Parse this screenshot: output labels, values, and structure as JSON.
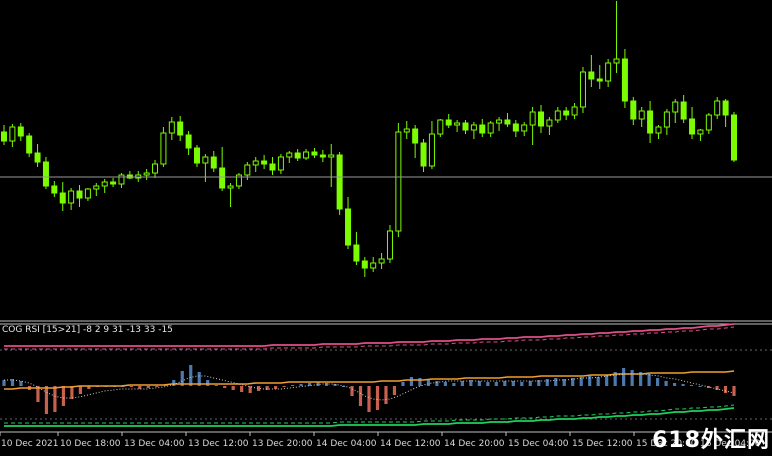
{
  "indicator": {
    "title": "COG RSI [15>21] -8 2 9 31 -13 33 -15"
  },
  "time_axis": {
    "labels": [
      "10 Dec 2021",
      "10 Dec 18:00",
      "13 Dec 04:00",
      "13 Dec 12:00",
      "13 Dec 20:00",
      "14 Dec 04:00",
      "14 Dec 12:00",
      "14 Dec 20:00",
      "15 Dec 04:00",
      "15 Dec 12:00",
      "15 Dec 20:00",
      "16 Dec 04:00"
    ]
  },
  "watermark": "618外汇网",
  "colors": {
    "background": "#000000",
    "candle": "#7CFC00",
    "hline": "#9a9a9a",
    "bar_up": "#4a7ab0",
    "bar_down": "#c8604e",
    "orange": "#f0a030",
    "pink": "#e0508a",
    "green": "#20d060",
    "dotted": "#d0d0d0"
  },
  "chart_data": {
    "type": "candlestick",
    "title": "",
    "note": "Price axis tick labels are not visible in the screenshot; values are relative levels (0-100).",
    "candles": [
      {
        "o": 45,
        "h": 52,
        "l": 32,
        "c": 36
      },
      {
        "o": 36,
        "h": 53,
        "l": 30,
        "c": 50
      },
      {
        "o": 50,
        "h": 54,
        "l": 36,
        "c": 41
      },
      {
        "o": 41,
        "h": 44,
        "l": 20,
        "c": 24
      },
      {
        "o": 24,
        "h": 33,
        "l": 10,
        "c": 15
      },
      {
        "o": 15,
        "h": 20,
        "l": -12,
        "c": -9
      },
      {
        "o": -9,
        "h": -4,
        "l": -20,
        "c": -16
      },
      {
        "o": -16,
        "h": -5,
        "l": -34,
        "c": -26
      },
      {
        "o": -26,
        "h": -11,
        "l": -33,
        "c": -14
      },
      {
        "o": -14,
        "h": -8,
        "l": -30,
        "c": -21
      },
      {
        "o": -21,
        "h": -11,
        "l": -24,
        "c": -12
      },
      {
        "o": -12,
        "h": -6,
        "l": -19,
        "c": -9
      },
      {
        "o": -9,
        "h": -2,
        "l": -16,
        "c": -5
      },
      {
        "o": -5,
        "h": -1,
        "l": -10,
        "c": -7
      },
      {
        "o": -7,
        "h": 4,
        "l": -11,
        "c": 2
      },
      {
        "o": 2,
        "h": 6,
        "l": -2,
        "c": -1
      },
      {
        "o": -1,
        "h": 6,
        "l": -5,
        "c": 2
      },
      {
        "o": 2,
        "h": 8,
        "l": -3,
        "c": 4
      },
      {
        "o": 4,
        "h": 17,
        "l": -1,
        "c": 13
      },
      {
        "o": 13,
        "h": 50,
        "l": 10,
        "c": 44
      },
      {
        "o": 44,
        "h": 60,
        "l": 37,
        "c": 55
      },
      {
        "o": 55,
        "h": 61,
        "l": 36,
        "c": 42
      },
      {
        "o": 42,
        "h": 46,
        "l": 22,
        "c": 29
      },
      {
        "o": 29,
        "h": 32,
        "l": 10,
        "c": 14
      },
      {
        "o": 14,
        "h": 23,
        "l": -5,
        "c": 20
      },
      {
        "o": 20,
        "h": 26,
        "l": 5,
        "c": 9
      },
      {
        "o": 9,
        "h": 30,
        "l": -14,
        "c": -11
      },
      {
        "o": -11,
        "h": -6,
        "l": -30,
        "c": -9
      },
      {
        "o": -9,
        "h": 4,
        "l": -12,
        "c": 2
      },
      {
        "o": 2,
        "h": 15,
        "l": -3,
        "c": 12
      },
      {
        "o": 12,
        "h": 20,
        "l": 5,
        "c": 16
      },
      {
        "o": 16,
        "h": 22,
        "l": 8,
        "c": 13
      },
      {
        "o": 13,
        "h": 20,
        "l": 2,
        "c": 7
      },
      {
        "o": 7,
        "h": 23,
        "l": 3,
        "c": 20
      },
      {
        "o": 20,
        "h": 26,
        "l": 14,
        "c": 24
      },
      {
        "o": 24,
        "h": 28,
        "l": 16,
        "c": 19
      },
      {
        "o": 19,
        "h": 28,
        "l": 17,
        "c": 25
      },
      {
        "o": 25,
        "h": 29,
        "l": 19,
        "c": 22
      },
      {
        "o": 22,
        "h": 27,
        "l": 15,
        "c": 20
      },
      {
        "o": 20,
        "h": 33,
        "l": -10,
        "c": 22
      },
      {
        "o": 22,
        "h": 25,
        "l": -38,
        "c": -32
      },
      {
        "o": -32,
        "h": -20,
        "l": -72,
        "c": -68
      },
      {
        "o": -68,
        "h": -55,
        "l": -88,
        "c": -84
      },
      {
        "o": -84,
        "h": -80,
        "l": -100,
        "c": -91
      },
      {
        "o": -91,
        "h": -80,
        "l": -95,
        "c": -86
      },
      {
        "o": -86,
        "h": -76,
        "l": -92,
        "c": -82
      },
      {
        "o": -82,
        "h": -48,
        "l": -86,
        "c": -54
      },
      {
        "o": -54,
        "h": 54,
        "l": -60,
        "c": 45
      },
      {
        "o": 45,
        "h": 56,
        "l": 38,
        "c": 48
      },
      {
        "o": 48,
        "h": 52,
        "l": 19,
        "c": 34
      },
      {
        "o": 34,
        "h": 38,
        "l": 5,
        "c": 11
      },
      {
        "o": 11,
        "h": 56,
        "l": 8,
        "c": 43
      },
      {
        "o": 43,
        "h": 58,
        "l": 40,
        "c": 57
      },
      {
        "o": 57,
        "h": 63,
        "l": 49,
        "c": 52
      },
      {
        "o": 52,
        "h": 57,
        "l": 45,
        "c": 54
      },
      {
        "o": 54,
        "h": 57,
        "l": 43,
        "c": 47
      },
      {
        "o": 47,
        "h": 55,
        "l": 38,
        "c": 52
      },
      {
        "o": 52,
        "h": 58,
        "l": 40,
        "c": 44
      },
      {
        "o": 44,
        "h": 56,
        "l": 40,
        "c": 54
      },
      {
        "o": 54,
        "h": 60,
        "l": 46,
        "c": 57
      },
      {
        "o": 57,
        "h": 64,
        "l": 50,
        "c": 53
      },
      {
        "o": 53,
        "h": 57,
        "l": 40,
        "c": 46
      },
      {
        "o": 46,
        "h": 55,
        "l": 41,
        "c": 52
      },
      {
        "o": 52,
        "h": 70,
        "l": 32,
        "c": 65
      },
      {
        "o": 65,
        "h": 72,
        "l": 44,
        "c": 51
      },
      {
        "o": 51,
        "h": 60,
        "l": 42,
        "c": 57
      },
      {
        "o": 57,
        "h": 70,
        "l": 54,
        "c": 66
      },
      {
        "o": 66,
        "h": 70,
        "l": 57,
        "c": 62
      },
      {
        "o": 62,
        "h": 74,
        "l": 58,
        "c": 70
      },
      {
        "o": 70,
        "h": 110,
        "l": 64,
        "c": 105
      },
      {
        "o": 105,
        "h": 122,
        "l": 90,
        "c": 98
      },
      {
        "o": 98,
        "h": 112,
        "l": 88,
        "c": 96
      },
      {
        "o": 96,
        "h": 118,
        "l": 90,
        "c": 114
      },
      {
        "o": 114,
        "h": 176,
        "l": 104,
        "c": 118
      },
      {
        "o": 118,
        "h": 128,
        "l": 69,
        "c": 76
      },
      {
        "o": 76,
        "h": 80,
        "l": 52,
        "c": 58
      },
      {
        "o": 58,
        "h": 70,
        "l": 50,
        "c": 66
      },
      {
        "o": 66,
        "h": 76,
        "l": 34,
        "c": 44
      },
      {
        "o": 44,
        "h": 52,
        "l": 38,
        "c": 50
      },
      {
        "o": 50,
        "h": 68,
        "l": 42,
        "c": 65
      },
      {
        "o": 65,
        "h": 78,
        "l": 54,
        "c": 75
      },
      {
        "o": 75,
        "h": 82,
        "l": 54,
        "c": 58
      },
      {
        "o": 58,
        "h": 70,
        "l": 38,
        "c": 43
      },
      {
        "o": 43,
        "h": 48,
        "l": 36,
        "c": 47
      },
      {
        "o": 47,
        "h": 64,
        "l": 43,
        "c": 62
      },
      {
        "o": 62,
        "h": 80,
        "l": 58,
        "c": 76
      },
      {
        "o": 76,
        "h": 78,
        "l": 50,
        "c": 62
      },
      {
        "o": 62,
        "h": 65,
        "l": 15,
        "c": 17
      }
    ],
    "indicator_bars": [
      6,
      7,
      5,
      -4,
      -16,
      -28,
      -26,
      -20,
      -13,
      -8,
      -3,
      -1,
      0,
      0,
      0,
      -1,
      -3,
      -2,
      -1,
      1,
      6,
      15,
      21,
      14,
      6,
      1,
      -2,
      -4,
      -6,
      -7,
      -5,
      -4,
      -3,
      -1,
      1,
      2,
      3,
      4,
      3,
      2,
      0,
      -10,
      -20,
      -26,
      -24,
      -18,
      -9,
      4,
      9,
      8,
      7,
      5,
      4,
      3,
      5,
      6,
      5,
      4,
      4,
      5,
      5,
      4,
      5,
      6,
      7,
      8,
      7,
      8,
      9,
      10,
      9,
      11,
      14,
      18,
      16,
      14,
      12,
      8,
      5,
      3,
      2,
      1,
      0,
      -2,
      -4,
      -7,
      -10
    ],
    "orange_line": [
      -3,
      -3,
      -2,
      -2,
      -2,
      -2,
      -2,
      -1,
      -1,
      0,
      0,
      0,
      0,
      0,
      0,
      1,
      1,
      1,
      1,
      1,
      2,
      2,
      2,
      2,
      2,
      2,
      2,
      2,
      2,
      2,
      3,
      3,
      3,
      3,
      4,
      4,
      4,
      4,
      4,
      4,
      4,
      4,
      4,
      4,
      4,
      5,
      5,
      5,
      6,
      6,
      6,
      7,
      7,
      7,
      7,
      8,
      8,
      8,
      8,
      8,
      9,
      9,
      9,
      9,
      10,
      10,
      10,
      10,
      10,
      10,
      11,
      11,
      11,
      12,
      12,
      12,
      12,
      13,
      13,
      13,
      13,
      13,
      14,
      14,
      14,
      14,
      14,
      15
    ],
    "pink_line": [
      40,
      40,
      40,
      40,
      40,
      40,
      40,
      40,
      40,
      40,
      40,
      40,
      40,
      40,
      40,
      40,
      40,
      40,
      40,
      40,
      40,
      40,
      40,
      40,
      40,
      40,
      40,
      40,
      40,
      40,
      40,
      40,
      41,
      41,
      41,
      41,
      41,
      41,
      42,
      42,
      42,
      42,
      42,
      43,
      43,
      43,
      43,
      44,
      44,
      44,
      44,
      45,
      45,
      45,
      46,
      46,
      46,
      47,
      47,
      47,
      48,
      48,
      49,
      49,
      49,
      50,
      50,
      51,
      51,
      52,
      52,
      53,
      53,
      54,
      54,
      55,
      55,
      56,
      56,
      57,
      57,
      58,
      58,
      59,
      60,
      60,
      61,
      62
    ],
    "green_line": [
      -40,
      -40,
      -40,
      -40,
      -40,
      -40,
      -40,
      -40,
      -40,
      -40,
      -40,
      -40,
      -40,
      -40,
      -40,
      -40,
      -40,
      -40,
      -40,
      -40,
      -40,
      -40,
      -40,
      -40,
      -40,
      -40,
      -40,
      -40,
      -40,
      -40,
      -40,
      -40,
      -40,
      -40,
      -40,
      -40,
      -40,
      -40,
      -40,
      -40,
      -39,
      -39,
      -39,
      -39,
      -39,
      -39,
      -39,
      -39,
      -39,
      -39,
      -38,
      -38,
      -38,
      -38,
      -37,
      -37,
      -37,
      -37,
      -36,
      -36,
      -36,
      -35,
      -35,
      -35,
      -34,
      -34,
      -33,
      -33,
      -33,
      -32,
      -32,
      -31,
      -31,
      -30,
      -30,
      -29,
      -29,
      -28,
      -28,
      -27,
      -26,
      -26,
      -25,
      -25,
      -24,
      -24,
      -23,
      -22
    ],
    "dotted_line": [
      6,
      6,
      5,
      3,
      -1,
      -6,
      -10,
      -12,
      -12,
      -11,
      -9,
      -7,
      -5,
      -4,
      -3,
      -3,
      -3,
      -3,
      -2,
      -1,
      1,
      4,
      8,
      10,
      10,
      8,
      6,
      4,
      2,
      0,
      -2,
      -3,
      -3,
      -3,
      -2,
      -1,
      0,
      1,
      2,
      2,
      1,
      -1,
      -5,
      -10,
      -13,
      -14,
      -13,
      -10,
      -6,
      -2,
      1,
      3,
      4,
      5,
      5,
      5,
      5,
      5,
      5,
      5,
      5,
      5,
      5,
      5,
      5,
      5,
      6,
      6,
      7,
      8,
      8,
      9,
      10,
      11,
      12,
      12,
      12,
      11,
      10,
      8,
      7,
      5,
      3,
      1,
      -1,
      -3,
      -5,
      -7
    ]
  }
}
